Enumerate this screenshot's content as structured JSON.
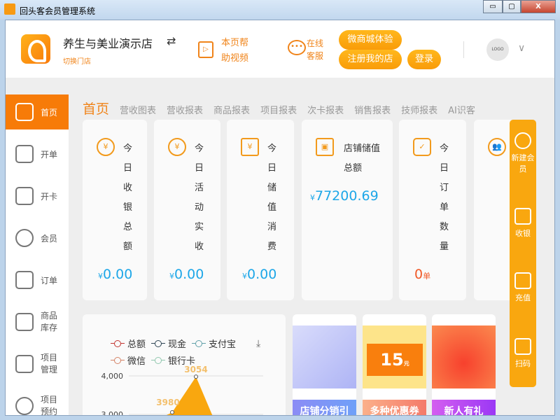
{
  "window": {
    "title": "回头客会员管理系统",
    "min": "▭",
    "max": "▢",
    "close": "X"
  },
  "header": {
    "store_name": "养生与美业演示店",
    "swap_icon": "⇄",
    "switch_store": "切换门店",
    "help_video": "本页帮助视频",
    "online_service": "在线客服",
    "wechat_mall": "微商城体验",
    "register": "注册我的店",
    "login": "登录",
    "avatar_text": "LOGO"
  },
  "sidebar": {
    "items": [
      {
        "label": "首页",
        "icon": "home-icon",
        "active": true
      },
      {
        "label": "开单",
        "icon": "bag-icon"
      },
      {
        "label": "开卡",
        "icon": "card-icon"
      },
      {
        "label": "会员",
        "icon": "user-icon"
      },
      {
        "label": "订单",
        "icon": "document-icon"
      },
      {
        "label": "商品库存",
        "icon": "box-icon"
      },
      {
        "label": "项目管理",
        "icon": "grid-icon"
      },
      {
        "label": "项目预约",
        "icon": "clock-icon"
      }
    ]
  },
  "tabs": [
    "首页",
    "营收图表",
    "营收报表",
    "商品报表",
    "项目报表",
    "次卡报表",
    "销售报表",
    "技师报表",
    "AI识客"
  ],
  "stats": [
    {
      "label": "今日收银总额",
      "value": "0.00",
      "prefix": "¥"
    },
    {
      "label": "今日活动实收",
      "value": "0.00",
      "prefix": "¥"
    },
    {
      "label": "今日储值消费",
      "value": "0.00",
      "prefix": "¥"
    },
    {
      "label": "店铺储值总额",
      "value": "77200.69",
      "prefix": "¥"
    },
    {
      "label": "今日订单数量",
      "value": "0",
      "suffix": "单"
    }
  ],
  "float_bar": [
    {
      "label": "新建会员",
      "icon": "add-user-icon"
    },
    {
      "label": "收银",
      "icon": "monitor-icon"
    },
    {
      "label": "充值",
      "icon": "wallet-icon"
    },
    {
      "label": "扫码",
      "icon": "scan-icon"
    }
  ],
  "chart_data": {
    "type": "area",
    "legend": [
      "总额",
      "现金",
      "支付宝",
      "微信",
      "银行卡"
    ],
    "yticks": [
      "4,000",
      "3,000"
    ],
    "data_labels": [
      "3980",
      "3054"
    ],
    "values": [
      3054,
      3980
    ],
    "colors": {
      "总额": "#c23531",
      "现金": "#2f4554",
      "支付宝": "#61a0a8",
      "微信": "#d48265",
      "银行卡": "#91c7ae",
      "area": "#f9a70f"
    }
  },
  "promos": [
    {
      "label": "店铺分销引"
    },
    {
      "label": "多种优惠券",
      "badge": "15",
      "unit": "元"
    },
    {
      "label": "新人有礼"
    }
  ],
  "colors": {
    "accent": "#f77b08",
    "amount": "#1ea7e8"
  }
}
